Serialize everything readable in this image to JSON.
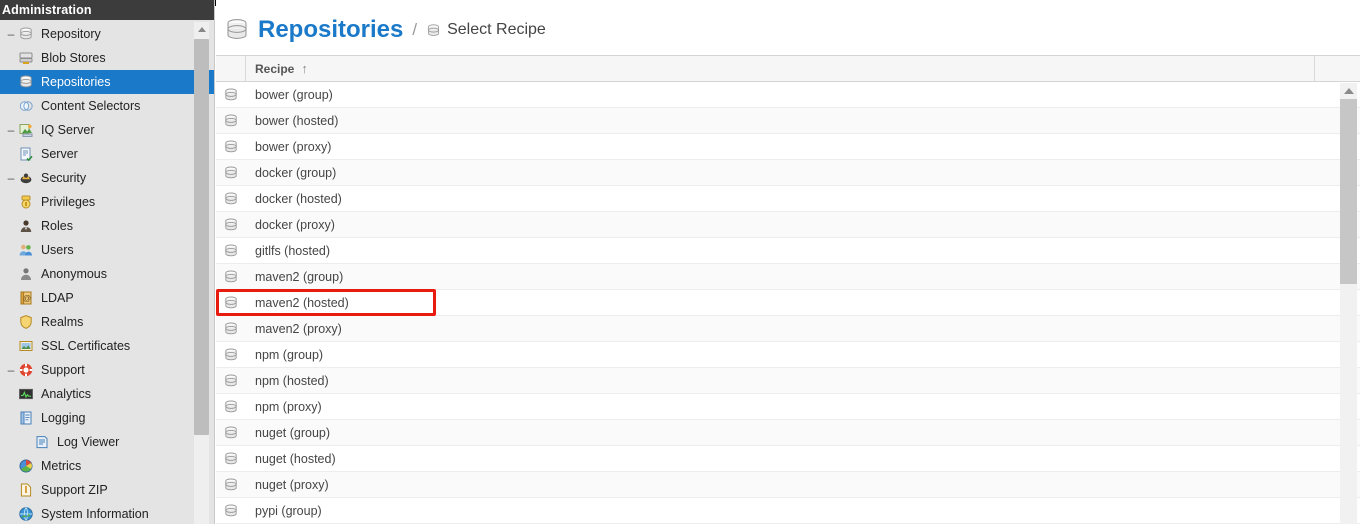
{
  "window": {
    "admin_bar_title": "Administration"
  },
  "sidebar": {
    "items": [
      {
        "label": "Repository",
        "level": 0,
        "twisty": "–",
        "icon": "database-icon",
        "selected": false
      },
      {
        "label": "Blob Stores",
        "level": 1,
        "twisty": "",
        "icon": "blob-store-icon",
        "selected": false
      },
      {
        "label": "Repositories",
        "level": 1,
        "twisty": "",
        "icon": "database-icon",
        "selected": true
      },
      {
        "label": "Content Selectors",
        "level": 1,
        "twisty": "",
        "icon": "content-selector-icon",
        "selected": false
      },
      {
        "label": "IQ Server",
        "level": 0,
        "twisty": "–",
        "icon": "iq-server-icon",
        "selected": false
      },
      {
        "label": "Server",
        "level": 1,
        "twisty": "",
        "icon": "server-icon",
        "selected": false
      },
      {
        "label": "Security",
        "level": 0,
        "twisty": "–",
        "icon": "security-icon",
        "selected": false
      },
      {
        "label": "Privileges",
        "level": 1,
        "twisty": "",
        "icon": "privileges-icon",
        "selected": false
      },
      {
        "label": "Roles",
        "level": 1,
        "twisty": "",
        "icon": "roles-icon",
        "selected": false
      },
      {
        "label": "Users",
        "level": 1,
        "twisty": "",
        "icon": "users-icon",
        "selected": false
      },
      {
        "label": "Anonymous",
        "level": 1,
        "twisty": "",
        "icon": "anonymous-icon",
        "selected": false
      },
      {
        "label": "LDAP",
        "level": 1,
        "twisty": "",
        "icon": "ldap-icon",
        "selected": false
      },
      {
        "label": "Realms",
        "level": 1,
        "twisty": "",
        "icon": "realms-icon",
        "selected": false
      },
      {
        "label": "SSL Certificates",
        "level": 1,
        "twisty": "",
        "icon": "ssl-certificate-icon",
        "selected": false
      },
      {
        "label": "Support",
        "level": 0,
        "twisty": "–",
        "icon": "support-icon",
        "selected": false
      },
      {
        "label": "Analytics",
        "level": 1,
        "twisty": "",
        "icon": "analytics-icon",
        "selected": false
      },
      {
        "label": "Logging",
        "level": 1,
        "twisty": "–",
        "icon": "logging-icon",
        "selected": false
      },
      {
        "label": "Log Viewer",
        "level": 2,
        "twisty": "",
        "icon": "log-viewer-icon",
        "selected": false
      },
      {
        "label": "Metrics",
        "level": 1,
        "twisty": "",
        "icon": "metrics-icon",
        "selected": false
      },
      {
        "label": "Support ZIP",
        "level": 1,
        "twisty": "",
        "icon": "support-zip-icon",
        "selected": false
      },
      {
        "label": "System Information",
        "level": 1,
        "twisty": "",
        "icon": "system-information-icon",
        "selected": false
      }
    ]
  },
  "header": {
    "title": "Repositories",
    "separator": "/",
    "breadcrumb_current": "Select Recipe",
    "title_icon": "database-icon",
    "breadcrumb_icon": "database-icon",
    "accent_color": "#1a7ac9"
  },
  "grid": {
    "columns": [
      {
        "key": "icon",
        "label": ""
      },
      {
        "key": "recipe",
        "label": "Recipe",
        "sort": "asc",
        "sort_glyph": "↑"
      },
      {
        "key": "extra",
        "label": ""
      }
    ],
    "chevron_glyph": "❯",
    "rows": [
      {
        "recipe": "bower (group)",
        "icon": "database-icon"
      },
      {
        "recipe": "bower (hosted)",
        "icon": "database-icon"
      },
      {
        "recipe": "bower (proxy)",
        "icon": "database-icon"
      },
      {
        "recipe": "docker (group)",
        "icon": "database-icon"
      },
      {
        "recipe": "docker (hosted)",
        "icon": "database-icon"
      },
      {
        "recipe": "docker (proxy)",
        "icon": "database-icon"
      },
      {
        "recipe": "gitlfs (hosted)",
        "icon": "database-icon"
      },
      {
        "recipe": "maven2 (group)",
        "icon": "database-icon"
      },
      {
        "recipe": "maven2 (hosted)",
        "icon": "database-icon",
        "highlighted": true
      },
      {
        "recipe": "maven2 (proxy)",
        "icon": "database-icon"
      },
      {
        "recipe": "npm (group)",
        "icon": "database-icon"
      },
      {
        "recipe": "npm (hosted)",
        "icon": "database-icon"
      },
      {
        "recipe": "npm (proxy)",
        "icon": "database-icon"
      },
      {
        "recipe": "nuget (group)",
        "icon": "database-icon"
      },
      {
        "recipe": "nuget (hosted)",
        "icon": "database-icon"
      },
      {
        "recipe": "nuget (proxy)",
        "icon": "database-icon"
      },
      {
        "recipe": "pypi (group)",
        "icon": "database-icon"
      }
    ],
    "highlight_color": "#e81b0f"
  }
}
